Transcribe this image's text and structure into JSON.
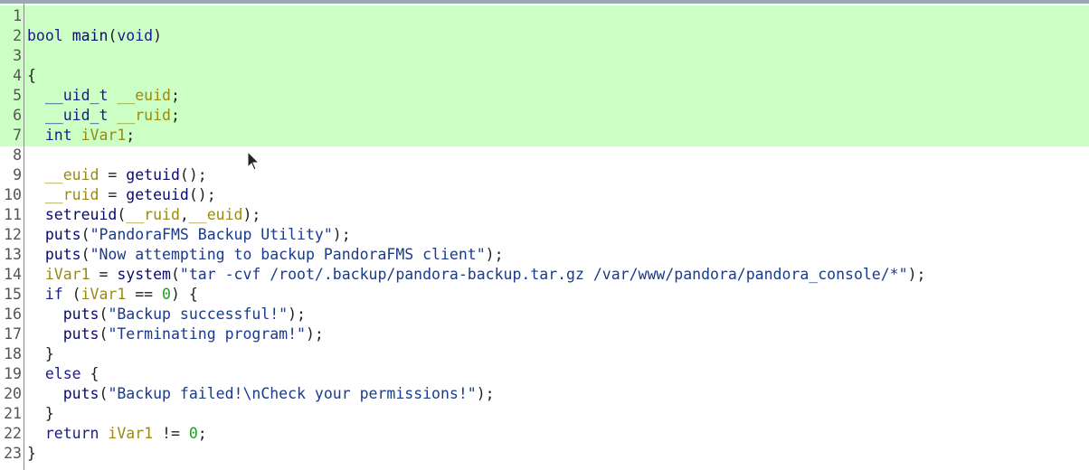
{
  "editor": {
    "highlight_color": "#ccffc3",
    "lines": [
      {
        "n": "1",
        "tokens": []
      },
      {
        "n": "2",
        "tokens": [
          {
            "t": "bool",
            "k": "type"
          },
          {
            "t": " ",
            "k": "plain"
          },
          {
            "t": "main",
            "k": "fn"
          },
          {
            "t": "(",
            "k": "plain"
          },
          {
            "t": "void",
            "k": "type"
          },
          {
            "t": ")",
            "k": "plain"
          }
        ]
      },
      {
        "n": "3",
        "tokens": []
      },
      {
        "n": "4",
        "tokens": [
          {
            "t": "{",
            "k": "plain"
          }
        ]
      },
      {
        "n": "5",
        "tokens": [
          {
            "t": "  ",
            "k": "plain"
          },
          {
            "t": "__uid_t",
            "k": "type"
          },
          {
            "t": " ",
            "k": "plain"
          },
          {
            "t": "__euid",
            "k": "var"
          },
          {
            "t": ";",
            "k": "plain"
          }
        ]
      },
      {
        "n": "6",
        "tokens": [
          {
            "t": "  ",
            "k": "plain"
          },
          {
            "t": "__uid_t",
            "k": "type"
          },
          {
            "t": " ",
            "k": "plain"
          },
          {
            "t": "__ruid",
            "k": "var"
          },
          {
            "t": ";",
            "k": "plain"
          }
        ]
      },
      {
        "n": "7",
        "tokens": [
          {
            "t": "  ",
            "k": "plain"
          },
          {
            "t": "int",
            "k": "type"
          },
          {
            "t": " ",
            "k": "plain"
          },
          {
            "t": "iVar1",
            "k": "var"
          },
          {
            "t": ";",
            "k": "plain"
          }
        ]
      },
      {
        "n": "8",
        "tokens": []
      },
      {
        "n": "9",
        "tokens": [
          {
            "t": "  ",
            "k": "plain"
          },
          {
            "t": "__euid",
            "k": "var"
          },
          {
            "t": " = ",
            "k": "plain"
          },
          {
            "t": "getuid",
            "k": "fn"
          },
          {
            "t": "();",
            "k": "plain"
          }
        ]
      },
      {
        "n": "10",
        "tokens": [
          {
            "t": "  ",
            "k": "plain"
          },
          {
            "t": "__ruid",
            "k": "var"
          },
          {
            "t": " = ",
            "k": "plain"
          },
          {
            "t": "geteuid",
            "k": "fn"
          },
          {
            "t": "();",
            "k": "plain"
          }
        ]
      },
      {
        "n": "11",
        "tokens": [
          {
            "t": "  ",
            "k": "plain"
          },
          {
            "t": "setreuid",
            "k": "fn"
          },
          {
            "t": "(",
            "k": "plain"
          },
          {
            "t": "__ruid",
            "k": "var"
          },
          {
            "t": ",",
            "k": "plain"
          },
          {
            "t": "__euid",
            "k": "var"
          },
          {
            "t": ");",
            "k": "plain"
          }
        ]
      },
      {
        "n": "12",
        "tokens": [
          {
            "t": "  ",
            "k": "plain"
          },
          {
            "t": "puts",
            "k": "fn"
          },
          {
            "t": "(",
            "k": "plain"
          },
          {
            "t": "\"PandoraFMS Backup Utility\"",
            "k": "str"
          },
          {
            "t": ");",
            "k": "plain"
          }
        ]
      },
      {
        "n": "13",
        "tokens": [
          {
            "t": "  ",
            "k": "plain"
          },
          {
            "t": "puts",
            "k": "fn"
          },
          {
            "t": "(",
            "k": "plain"
          },
          {
            "t": "\"Now attempting to backup PandoraFMS client\"",
            "k": "str"
          },
          {
            "t": ");",
            "k": "plain"
          }
        ]
      },
      {
        "n": "14",
        "tokens": [
          {
            "t": "  ",
            "k": "plain"
          },
          {
            "t": "iVar1",
            "k": "var"
          },
          {
            "t": " = ",
            "k": "plain"
          },
          {
            "t": "system",
            "k": "fn"
          },
          {
            "t": "(",
            "k": "plain"
          },
          {
            "t": "\"tar -cvf /root/.backup/pandora-backup.tar.gz /var/www/pandora/pandora_console/*\"",
            "k": "str"
          },
          {
            "t": ");",
            "k": "plain"
          }
        ]
      },
      {
        "n": "15",
        "tokens": [
          {
            "t": "  ",
            "k": "plain"
          },
          {
            "t": "if",
            "k": "kw"
          },
          {
            "t": " (",
            "k": "plain"
          },
          {
            "t": "iVar1",
            "k": "var"
          },
          {
            "t": " == ",
            "k": "plain"
          },
          {
            "t": "0",
            "k": "num"
          },
          {
            "t": ") {",
            "k": "plain"
          }
        ]
      },
      {
        "n": "16",
        "tokens": [
          {
            "t": "    ",
            "k": "plain"
          },
          {
            "t": "puts",
            "k": "fn"
          },
          {
            "t": "(",
            "k": "plain"
          },
          {
            "t": "\"Backup successful!\"",
            "k": "str"
          },
          {
            "t": ");",
            "k": "plain"
          }
        ]
      },
      {
        "n": "17",
        "tokens": [
          {
            "t": "    ",
            "k": "plain"
          },
          {
            "t": "puts",
            "k": "fn"
          },
          {
            "t": "(",
            "k": "plain"
          },
          {
            "t": "\"Terminating program!\"",
            "k": "str"
          },
          {
            "t": ");",
            "k": "plain"
          }
        ]
      },
      {
        "n": "18",
        "tokens": [
          {
            "t": "  }",
            "k": "plain"
          }
        ]
      },
      {
        "n": "19",
        "tokens": [
          {
            "t": "  ",
            "k": "plain"
          },
          {
            "t": "else",
            "k": "kw"
          },
          {
            "t": " {",
            "k": "plain"
          }
        ]
      },
      {
        "n": "20",
        "tokens": [
          {
            "t": "    ",
            "k": "plain"
          },
          {
            "t": "puts",
            "k": "fn"
          },
          {
            "t": "(",
            "k": "plain"
          },
          {
            "t": "\"Backup failed!\\nCheck your permissions!\"",
            "k": "str"
          },
          {
            "t": ");",
            "k": "plain"
          }
        ]
      },
      {
        "n": "21",
        "tokens": [
          {
            "t": "  }",
            "k": "plain"
          }
        ]
      },
      {
        "n": "22",
        "tokens": [
          {
            "t": "  ",
            "k": "plain"
          },
          {
            "t": "return",
            "k": "kw"
          },
          {
            "t": " ",
            "k": "plain"
          },
          {
            "t": "iVar1",
            "k": "var"
          },
          {
            "t": " != ",
            "k": "plain"
          },
          {
            "t": "0",
            "k": "num"
          },
          {
            "t": ";",
            "k": "plain"
          }
        ]
      },
      {
        "n": "23",
        "tokens": [
          {
            "t": "}",
            "k": "plain"
          }
        ]
      }
    ]
  }
}
